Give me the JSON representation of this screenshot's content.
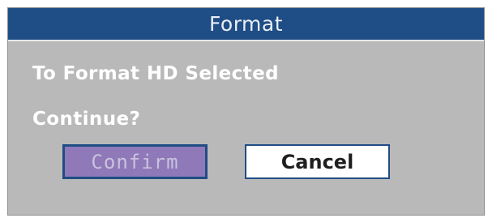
{
  "dialog": {
    "title": "Format",
    "message_line1": "To Format HD Selected",
    "message_line2": "Continue?",
    "buttons": {
      "confirm_label": "Confirm",
      "cancel_label": "Cancel"
    },
    "focused_button": "Confirm",
    "colors": {
      "titlebar": "#1f4d85",
      "background": "#b9b9b9",
      "focused_button_fill": "#8f79b9",
      "button_border": "#1f4d85"
    }
  }
}
